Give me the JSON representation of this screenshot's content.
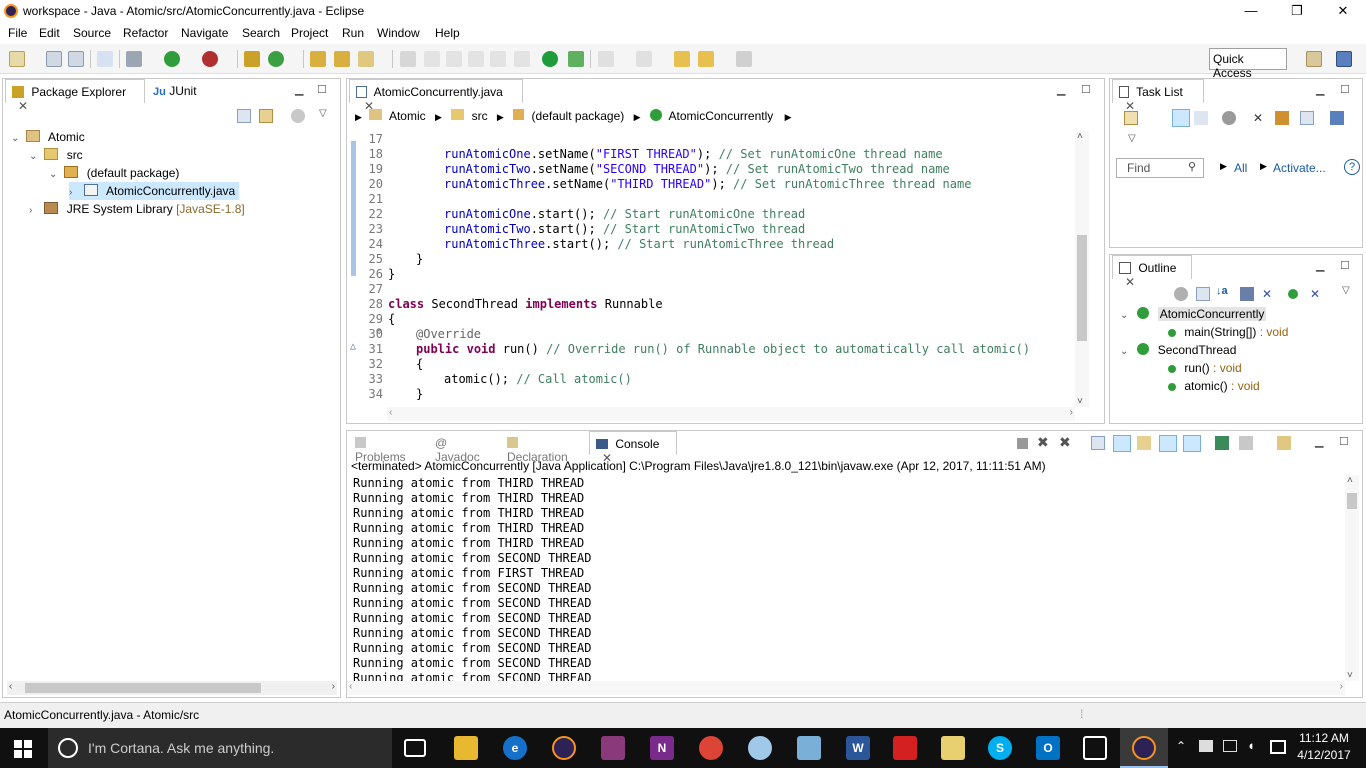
{
  "window": {
    "title": "workspace - Java - Atomic/src/AtomicConcurrently.java - Eclipse",
    "minimize": "—",
    "restore": "❐",
    "close": "✕"
  },
  "menu": [
    "File",
    "Edit",
    "Source",
    "Refactor",
    "Navigate",
    "Search",
    "Project",
    "Run",
    "Window",
    "Help"
  ],
  "toolbar": {
    "quick_access": "Quick Access"
  },
  "package_explorer": {
    "tab_label": "Package Explorer",
    "junit_tab": "JUnit",
    "tree": {
      "project": "Atomic",
      "src": "src",
      "package": "(default package)",
      "file": "AtomicConcurrently.java",
      "jre": "JRE System Library",
      "jre_version": "[JavaSE-1.8]"
    }
  },
  "editor": {
    "tab_label": "AtomicConcurrently.java",
    "breadcrumb": [
      "Atomic",
      "src",
      "(default package)",
      "AtomicConcurrently"
    ],
    "line_numbers": [
      "17",
      "18",
      "19",
      "20",
      "21",
      "22",
      "23",
      "24",
      "25",
      "26",
      "27",
      "28",
      "29",
      "30",
      "31",
      "32",
      "33",
      "34"
    ],
    "code": {
      "l18": {
        "var": "runAtomicOne",
        "call": ".setName(",
        "str": "\"FIRST THREAD\"",
        "end": "); ",
        "cm": "// Set runAtomicOne thread name"
      },
      "l19": {
        "var": "runAtomicTwo",
        "call": ".setName(",
        "str": "\"SECOND THREAD\"",
        "end": "); ",
        "cm": "// Set runAtomicTwo thread name"
      },
      "l20": {
        "var": "runAtomicThree",
        "call": ".setName(",
        "str": "\"THIRD THREAD\"",
        "end": "); ",
        "cm": "// Set runAtomicThree thread name"
      },
      "l22": {
        "var": "runAtomicOne",
        "call": ".start(); ",
        "cm": "// Start runAtomicOne thread"
      },
      "l23": {
        "var": "runAtomicTwo",
        "call": ".start(); ",
        "cm": "// Start runAtomicTwo thread"
      },
      "l24": {
        "var": "runAtomicThree",
        "call": ".start(); ",
        "cm": "// Start runAtomicThree thread"
      },
      "l25": "}",
      "l26": "}",
      "l28": {
        "kw1": "class",
        "name": " SecondThread ",
        "kw2": "implements",
        "rest": " Runnable"
      },
      "l29": "{",
      "l30": "@Override",
      "l31": {
        "kw1": "public",
        "kw2": "void",
        "rest": " run() ",
        "cm": "// Override run() of Runnable object to automatically call atomic()"
      },
      "l32": "{",
      "l33": {
        "rest": "atomic(); ",
        "cm": "// Call atomic()"
      },
      "l34": "}"
    }
  },
  "task_list": {
    "tab_label": "Task List",
    "find_placeholder": "Find",
    "all": "All",
    "activate": "Activate..."
  },
  "outline": {
    "tab_label": "Outline",
    "items": [
      {
        "name": "AtomicConcurrently",
        "type": ""
      },
      {
        "name": "main(String[])",
        "type": " : void"
      },
      {
        "name": "SecondThread",
        "type": ""
      },
      {
        "name": "run()",
        "type": " : void"
      },
      {
        "name": "atomic()",
        "type": " : void"
      }
    ]
  },
  "bottom_tabs": [
    "Problems",
    "Javadoc",
    "Declaration",
    "Console"
  ],
  "console": {
    "header": "<terminated> AtomicConcurrently [Java Application] C:\\Program Files\\Java\\jre1.8.0_121\\bin\\javaw.exe (Apr 12, 2017, 11:11:51 AM)",
    "lines": [
      "Running atomic from THIRD THREAD",
      "Running atomic from THIRD THREAD",
      "Running atomic from THIRD THREAD",
      "Running atomic from THIRD THREAD",
      "Running atomic from THIRD THREAD",
      "Running atomic from SECOND THREAD",
      "Running atomic from FIRST THREAD",
      "Running atomic from SECOND THREAD",
      "Running atomic from SECOND THREAD",
      "Running atomic from SECOND THREAD",
      "Running atomic from SECOND THREAD",
      "Running atomic from SECOND THREAD",
      "Running atomic from SECOND THREAD",
      "Running atomic from SECOND THREAD"
    ]
  },
  "status_bar": {
    "text": "AtomicConcurrently.java - Atomic/src"
  },
  "taskbar": {
    "cortana": "I'm Cortana. Ask me anything.",
    "time": "11:12 AM",
    "date": "4/12/2017"
  },
  "colors": {
    "keyword": "#7f0055",
    "comment": "#3f7f5f",
    "string": "#2a00ff",
    "field": "#0000c0",
    "selection": "#cce8ff"
  }
}
